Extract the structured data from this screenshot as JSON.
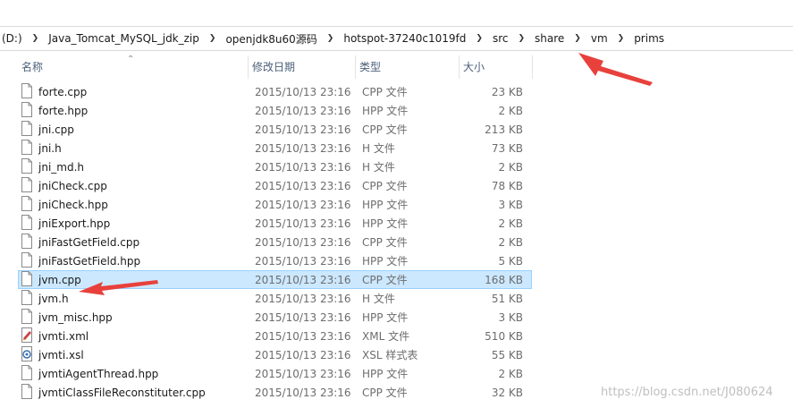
{
  "breadcrumb": [
    {
      "label": "(D:)"
    },
    {
      "label": "Java_Tomcat_MySQL_jdk_zip"
    },
    {
      "label": "openjdk8u60源码"
    },
    {
      "label": "hotspot-37240c1019fd"
    },
    {
      "label": "src"
    },
    {
      "label": "share"
    },
    {
      "label": "vm"
    },
    {
      "label": "prims"
    }
  ],
  "columns": {
    "name": "名称",
    "date": "修改日期",
    "type": "类型",
    "size": "大小"
  },
  "files": [
    {
      "name": "forte.cpp",
      "date": "2015/10/13 23:16",
      "type": "CPP 文件",
      "size": "23 KB",
      "icon": "file-icon"
    },
    {
      "name": "forte.hpp",
      "date": "2015/10/13 23:16",
      "type": "HPP 文件",
      "size": "2 KB",
      "icon": "file-icon"
    },
    {
      "name": "jni.cpp",
      "date": "2015/10/13 23:16",
      "type": "CPP 文件",
      "size": "213 KB",
      "icon": "file-icon"
    },
    {
      "name": "jni.h",
      "date": "2015/10/13 23:16",
      "type": "H 文件",
      "size": "73 KB",
      "icon": "file-icon"
    },
    {
      "name": "jni_md.h",
      "date": "2015/10/13 23:16",
      "type": "H 文件",
      "size": "2 KB",
      "icon": "file-icon"
    },
    {
      "name": "jniCheck.cpp",
      "date": "2015/10/13 23:16",
      "type": "CPP 文件",
      "size": "78 KB",
      "icon": "file-icon"
    },
    {
      "name": "jniCheck.hpp",
      "date": "2015/10/13 23:16",
      "type": "HPP 文件",
      "size": "3 KB",
      "icon": "file-icon"
    },
    {
      "name": "jniExport.hpp",
      "date": "2015/10/13 23:16",
      "type": "HPP 文件",
      "size": "2 KB",
      "icon": "file-icon"
    },
    {
      "name": "jniFastGetField.cpp",
      "date": "2015/10/13 23:16",
      "type": "CPP 文件",
      "size": "2 KB",
      "icon": "file-icon"
    },
    {
      "name": "jniFastGetField.hpp",
      "date": "2015/10/13 23:16",
      "type": "HPP 文件",
      "size": "5 KB",
      "icon": "file-icon"
    },
    {
      "name": "jvm.cpp",
      "date": "2015/10/13 23:16",
      "type": "CPP 文件",
      "size": "168 KB",
      "icon": "file-icon",
      "selected": true
    },
    {
      "name": "jvm.h",
      "date": "2015/10/13 23:16",
      "type": "H 文件",
      "size": "51 KB",
      "icon": "file-icon"
    },
    {
      "name": "jvm_misc.hpp",
      "date": "2015/10/13 23:16",
      "type": "HPP 文件",
      "size": "3 KB",
      "icon": "file-icon"
    },
    {
      "name": "jvmti.xml",
      "date": "2015/10/13 23:16",
      "type": "XML 文件",
      "size": "510 KB",
      "icon": "xml-file-icon"
    },
    {
      "name": "jvmti.xsl",
      "date": "2015/10/13 23:16",
      "type": "XSL 样式表",
      "size": "55 KB",
      "icon": "xsl-file-icon"
    },
    {
      "name": "jvmtiAgentThread.hpp",
      "date": "2015/10/13 23:16",
      "type": "HPP 文件",
      "size": "2 KB",
      "icon": "file-icon"
    },
    {
      "name": "jvmtiClassFileReconstituter.cpp",
      "date": "2015/10/13 23:16",
      "type": "CPP 文件",
      "size": "32 KB",
      "icon": "file-icon"
    }
  ],
  "watermark": "https://blog.csdn.net/J080624",
  "colors": {
    "selection_bg": "#cce8ff",
    "selection_border": "#99d1ff",
    "header_text": "#4c607a",
    "annotation_arrow": "#e8413c"
  }
}
